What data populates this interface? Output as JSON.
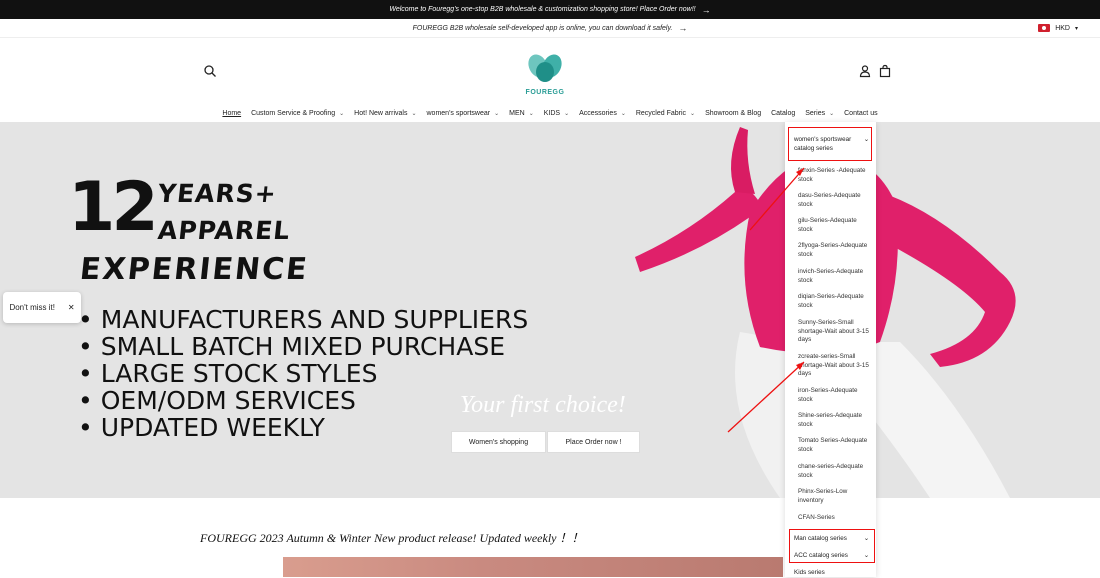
{
  "announcement": {
    "bar1_text": "Welcome to Fouregg's one-stop B2B wholesale & customization shopping store! Place Order now!!",
    "bar2_text": "FOUREGG B2B wholesale self-developed app is online, you can download it safely.",
    "arrow": "→"
  },
  "currency": {
    "code": "HKD",
    "caret": "▾"
  },
  "logo": {
    "text": "FOUREGG"
  },
  "nav": {
    "items": [
      {
        "label": "Home",
        "chev": ""
      },
      {
        "label": "Custom Service & Proofing",
        "chev": "⌄"
      },
      {
        "label": "Hot! New arrivals",
        "chev": "⌄"
      },
      {
        "label": "women's sportswear",
        "chev": "⌄"
      },
      {
        "label": "MEN",
        "chev": "⌄"
      },
      {
        "label": "KIDS",
        "chev": "⌄"
      },
      {
        "label": "Accessories",
        "chev": "⌄"
      },
      {
        "label": "Recycled Fabric",
        "chev": "⌄"
      },
      {
        "label": "Showroom & Blog",
        "chev": ""
      },
      {
        "label": "Catalog",
        "chev": ""
      },
      {
        "label": "Series",
        "chev": "⌄"
      },
      {
        "label": "Contact us",
        "chev": ""
      }
    ]
  },
  "hero": {
    "big_number": "12",
    "years": "YEARS+",
    "apparel": "APPAREL",
    "experience": "EXPERIENCE",
    "bullets": [
      "MANUFACTURERS AND SUPPLIERS",
      "SMALL BATCH MIXED PURCHASE",
      "LARGE STOCK STYLES",
      "OEM/ODM SERVICES",
      "UPDATED WEEKLY"
    ],
    "tagline": "Your first choice!",
    "btn_womens": "Women's shopping",
    "btn_order": "Place Order now !"
  },
  "popup": {
    "text": "Don't miss it!",
    "close": "✕"
  },
  "dropdown": {
    "head1": "women's sportswear catalog series",
    "chev": "⌄",
    "items": [
      "fanxin-Series -Adequate stock",
      "dasu-Series-Adequate stock",
      "gilu-Series-Adequate stock",
      "2flyoga-Series-Adequate stock",
      "invich-Series-Adequate stock",
      "diqian-Series-Adequate stock",
      "Sunny-Series-Small shortage-Wait about 3-15 days",
      "zcreate-series-Small shortage-Wait about 3-15 days",
      "iron-Series-Adequate stock",
      "Shine-series-Adequate stock",
      "Tomato Series-Adequate stock",
      "chane-series-Adequate stock",
      "Phinx-Series-Low inventory",
      "CFAN-Series"
    ],
    "head2": "Man catalog series",
    "head3": "ACC catalog series",
    "head4": "Kids series"
  },
  "section": {
    "new_product": "FOUREGG 2023 Autumn & Winter New product release! Updated weekly ！！"
  },
  "colors": {
    "accent": "#2a9d96",
    "annotation": "#e11111",
    "shirt": "#e0206a"
  }
}
